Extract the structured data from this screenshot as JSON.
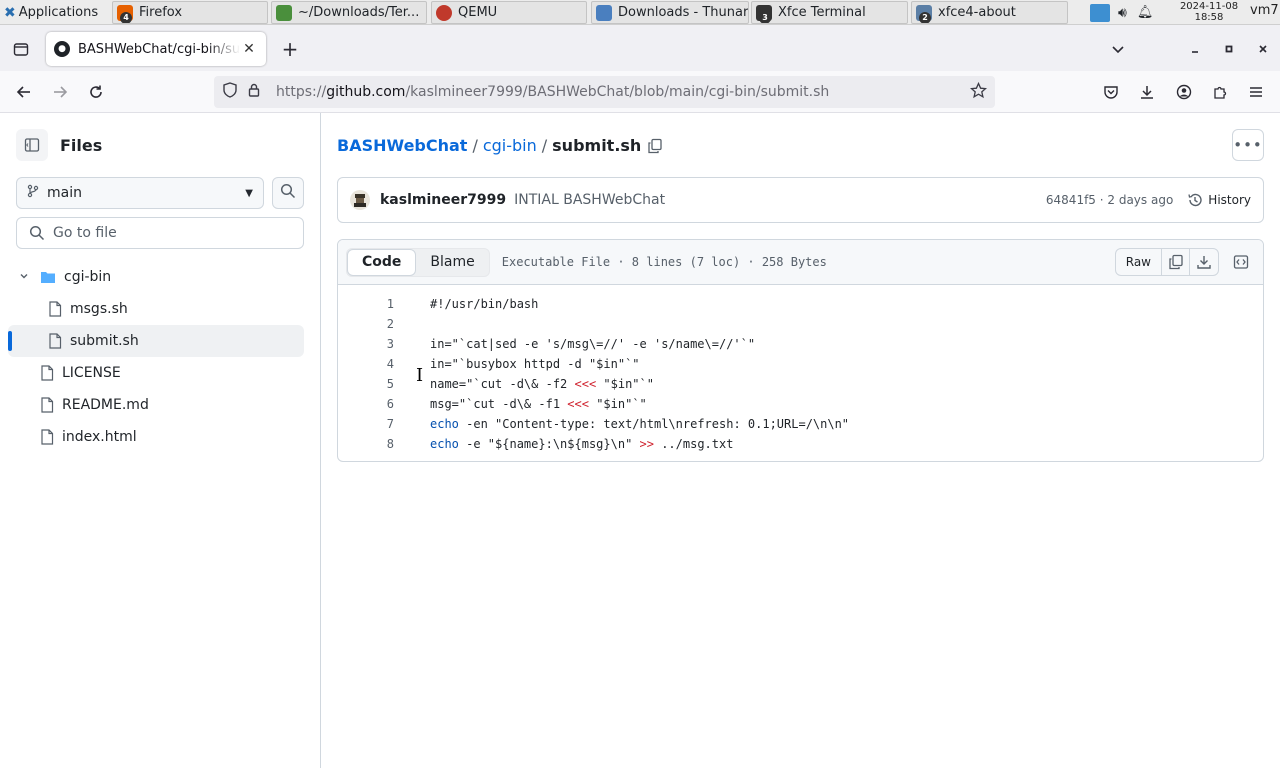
{
  "taskbar": {
    "applications_label": "Applications",
    "tasks": [
      {
        "label": "Firefox",
        "badge": "4",
        "icon": "firefox-icon",
        "color": "#e66000"
      },
      {
        "label": "~/Downloads/Ter...",
        "badge": "",
        "icon": "text-editor-icon",
        "color": "#4a8f3c"
      },
      {
        "label": "QEMU",
        "badge": "",
        "icon": "qemu-icon",
        "color": "#c0392b"
      },
      {
        "label": "Downloads - Thunar",
        "badge": "",
        "icon": "folder-icon",
        "color": "#4a7fbf"
      },
      {
        "label": "Xfce Terminal",
        "badge": "3",
        "icon": "terminal-icon",
        "color": "#333333"
      },
      {
        "label": "xfce4-about",
        "badge": "2",
        "icon": "about-icon",
        "color": "#5b7fa6"
      }
    ],
    "clock_date": "2024-11-08",
    "clock_time": "18:58",
    "user": "vm7"
  },
  "browser": {
    "tab_title": "BASHWebChat/cgi-bin/submit.sh",
    "url_prefix": "https://",
    "url_host": "github.com",
    "url_path": "/kaslmineer7999/BASHWebChat/blob/main/cgi-bin/submit.sh"
  },
  "sidebar": {
    "title": "Files",
    "branch": "main",
    "goto_placeholder": "Go to file",
    "tree": [
      {
        "label": "cgi-bin",
        "type": "folder",
        "depth": 0
      },
      {
        "label": "msgs.sh",
        "type": "file",
        "depth": 1
      },
      {
        "label": "submit.sh",
        "type": "file",
        "depth": 1,
        "active": true
      },
      {
        "label": "LICENSE",
        "type": "file",
        "depth": 0
      },
      {
        "label": "README.md",
        "type": "file",
        "depth": 0
      },
      {
        "label": "index.html",
        "type": "file",
        "depth": 0
      }
    ]
  },
  "breadcrumb": {
    "repo": "BASHWebChat",
    "folder": "cgi-bin",
    "file": "submit.sh",
    "sep": "/"
  },
  "commit": {
    "author": "kaslmineer7999",
    "message": "INTIAL BASHWebChat",
    "meta": "64841f5 · 2 days ago",
    "history_label": "History"
  },
  "file": {
    "tab_code": "Code",
    "tab_blame": "Blame",
    "info": "Executable File · 8 lines (7 loc) · 258 Bytes",
    "raw_label": "Raw",
    "lines": [
      {
        "n": "1",
        "text": "#!/usr/bin/bash"
      },
      {
        "n": "2",
        "text": ""
      },
      {
        "n": "3",
        "text": "in=\"`cat|sed -e 's/msg\\=//' -e 's/name\\=//'`\""
      },
      {
        "n": "4",
        "text": "in=\"`busybox httpd -d \"$in\"`\""
      },
      {
        "n": "5",
        "text": "name=\"`cut -d\\& -f2 <<< \"$in\"`\""
      },
      {
        "n": "6",
        "text": "msg=\"`cut -d\\& -f1 <<< \"$in\"`\""
      },
      {
        "n": "7",
        "text": "echo -en \"Content-type: text/html\\nrefresh: 0.1;URL=/\\n\\n\""
      },
      {
        "n": "8",
        "text": "echo -e \"${name}:\\n${msg}\\n\" >> ../msg.txt"
      }
    ]
  },
  "colors": {
    "link": "#0969da",
    "keyword": "#0550ae",
    "operator": "#cf222e",
    "muted": "#57606a",
    "border": "#d0d7de"
  }
}
